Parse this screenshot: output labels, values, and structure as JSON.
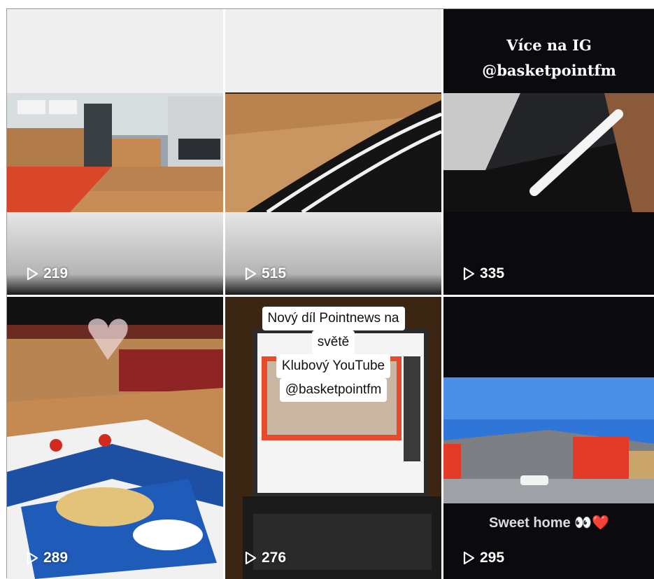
{
  "grid": {
    "videos": [
      {
        "views": "219"
      },
      {
        "views": "515"
      },
      {
        "views": "335",
        "caption_lines": [
          "Více na IG",
          "@basketpointfm"
        ]
      },
      {
        "views": "289"
      },
      {
        "views": "276",
        "caption_lines": [
          "Nový díl Pointnews na",
          "světě",
          "Klubový YouTube",
          "@basketpointfm"
        ]
      },
      {
        "views": "295",
        "caption": "Sweet home 👀❤️"
      }
    ]
  },
  "icons": {
    "views": "play-outline-icon"
  },
  "colors": {
    "court_red": "#d9472b",
    "court_wood": "#c98b4f",
    "tile_dark": "#0b0b0f"
  }
}
